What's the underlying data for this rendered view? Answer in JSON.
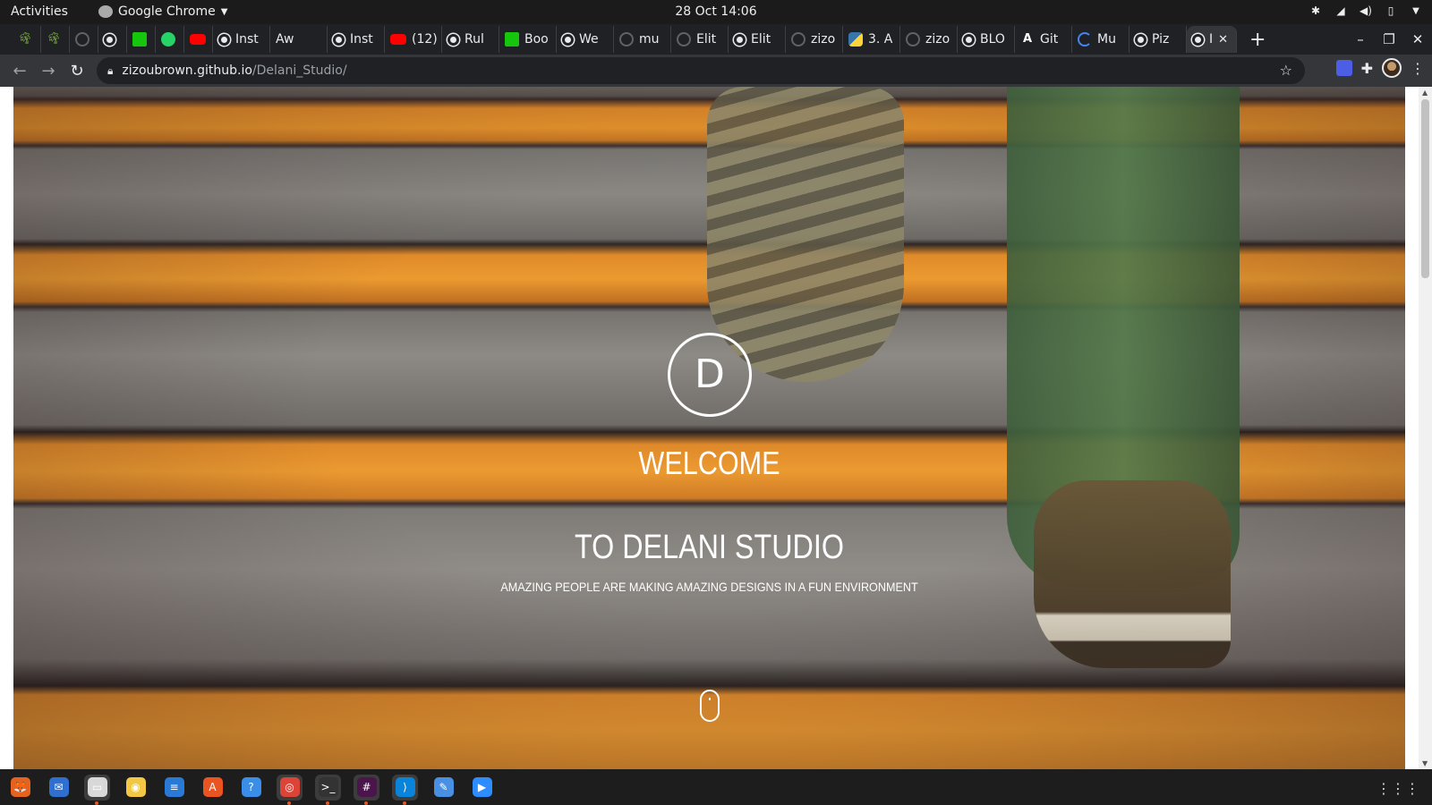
{
  "topbar": {
    "activities": "Activities",
    "app_name": "Google Chrome",
    "clock": "28 Oct  14:06"
  },
  "tabs": [
    {
      "favicon": "plant-icon",
      "label": ""
    },
    {
      "favicon": "plant-icon",
      "label": ""
    },
    {
      "favicon": "github-icon",
      "label": ""
    },
    {
      "favicon": "globe-icon",
      "label": ""
    },
    {
      "favicon": "green-app-icon",
      "label": ""
    },
    {
      "favicon": "whatsapp-icon",
      "label": ""
    },
    {
      "favicon": "youtube-icon",
      "label": ""
    },
    {
      "favicon": "globe-icon",
      "label": "Inst"
    },
    {
      "favicon": "none",
      "label": "Aw"
    },
    {
      "favicon": "globe-icon",
      "label": "Inst"
    },
    {
      "favicon": "youtube-icon",
      "label": "(12)"
    },
    {
      "favicon": "globe-icon",
      "label": "Rul"
    },
    {
      "favicon": "green-app-icon",
      "label": "Boo"
    },
    {
      "favicon": "globe-icon",
      "label": "We"
    },
    {
      "favicon": "github-icon",
      "label": "mu"
    },
    {
      "favicon": "github-icon",
      "label": "Elit"
    },
    {
      "favicon": "globe-icon",
      "label": "Elit"
    },
    {
      "favicon": "github-icon",
      "label": "zizo"
    },
    {
      "favicon": "python-icon",
      "label": "3. A"
    },
    {
      "favicon": "github-icon",
      "label": "zizo"
    },
    {
      "favicon": "globe-icon",
      "label": "BLO"
    },
    {
      "favicon": "a-icon",
      "label": "Git"
    },
    {
      "favicon": "loading-icon",
      "label": "Mu"
    },
    {
      "favicon": "globe-icon",
      "label": "Piz"
    }
  ],
  "active_tab": {
    "favicon": "globe-icon",
    "label": "I"
  },
  "address": {
    "host": "zizoubrown.github.io",
    "path": "/Delani_Studio/"
  },
  "hero": {
    "logo_letter": "D",
    "welcome": "WELCOME",
    "title": "TO DELANI STUDIO",
    "tagline": "AMAZING PEOPLE ARE MAKING AMAZING DESIGNS IN A FUN ENVIRONMENT"
  },
  "dock": [
    {
      "name": "firefox",
      "glyph": "🦊",
      "bg": "#e8621f",
      "active": false
    },
    {
      "name": "thunderbird",
      "glyph": "✉",
      "bg": "#2f6fcf",
      "active": false
    },
    {
      "name": "files",
      "glyph": "▭",
      "bg": "#d8d8d8",
      "active": true
    },
    {
      "name": "rhythmbox",
      "glyph": "◉",
      "bg": "#f2c744",
      "active": false
    },
    {
      "name": "writer",
      "glyph": "≡",
      "bg": "#2a7ad5",
      "active": false
    },
    {
      "name": "software",
      "glyph": "A",
      "bg": "#e95420",
      "active": false
    },
    {
      "name": "help",
      "glyph": "?",
      "bg": "#3b8ee8",
      "active": false
    },
    {
      "name": "chrome",
      "glyph": "◎",
      "bg": "#db4437",
      "active": true
    },
    {
      "name": "terminal",
      "glyph": ">_",
      "bg": "#333333",
      "active": true
    },
    {
      "name": "slack",
      "glyph": "#",
      "bg": "#4a154b",
      "active": true
    },
    {
      "name": "vscode",
      "glyph": "⟩",
      "bg": "#0a84d8",
      "active": true
    },
    {
      "name": "text-editor",
      "glyph": "✎",
      "bg": "#4a90e2",
      "active": false
    },
    {
      "name": "zoom",
      "glyph": "▶",
      "bg": "#2d8cff",
      "active": false
    }
  ]
}
